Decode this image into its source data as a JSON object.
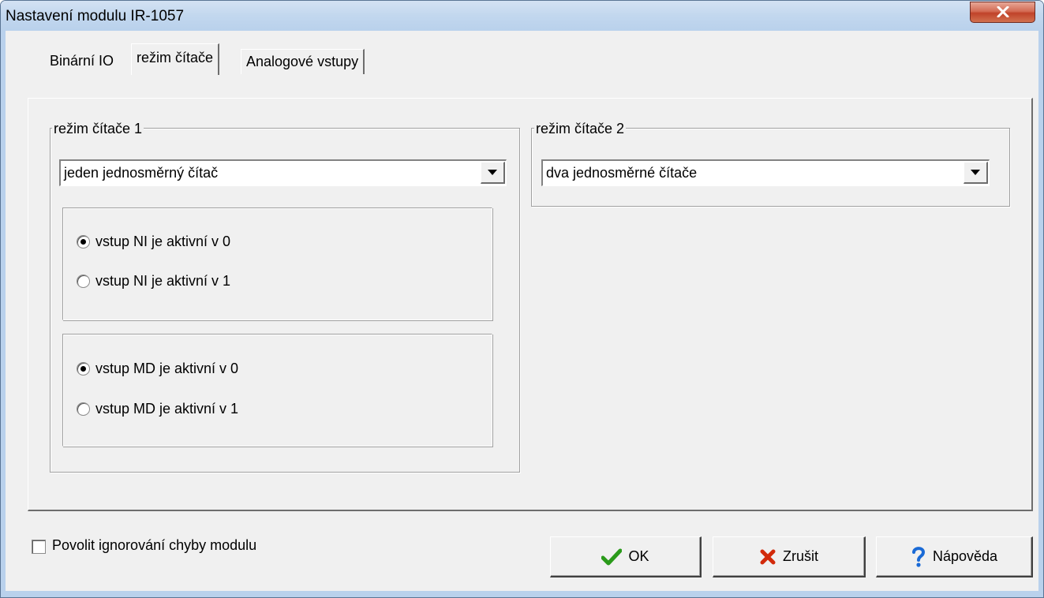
{
  "window": {
    "title": "Nastavení modulu IR-1057"
  },
  "tabs": [
    {
      "label": "Binární IO",
      "active": false
    },
    {
      "label": "režim čítače",
      "active": true
    },
    {
      "label": "Analogové vstupy",
      "active": false
    }
  ],
  "group1": {
    "label": "režim čítače 1",
    "combo_value": "jeden jednosměrný čítač",
    "ni_options": [
      {
        "label": "vstup NI je aktivní v 0",
        "checked": true
      },
      {
        "label": "vstup NI je aktivní v 1",
        "checked": false
      }
    ],
    "md_options": [
      {
        "label": "vstup MD je aktivní v 0",
        "checked": true
      },
      {
        "label": "vstup MD je aktivní v 1",
        "checked": false
      }
    ]
  },
  "group2": {
    "label": "režim čítače 2",
    "combo_value": "dva jednosměrné čítače"
  },
  "footer": {
    "checkbox_label": "Povolit ignorování chyby modulu",
    "checkbox_checked": false,
    "ok_label": "OK",
    "cancel_label": "Zrušit",
    "help_label": "Nápověda"
  },
  "icons": {
    "close": "close-icon",
    "ok": "checkmark-icon",
    "cancel": "cross-icon",
    "help": "question-icon",
    "dropdown": "chevron-down-icon"
  },
  "colors": {
    "title_bar": "#c2d7ee",
    "close_button": "#c0432a",
    "dialog_face": "#f0f0f0",
    "ok_icon": "#2a9a1a",
    "cancel_icon": "#d22a0a",
    "help_icon": "#1a6ad6"
  }
}
